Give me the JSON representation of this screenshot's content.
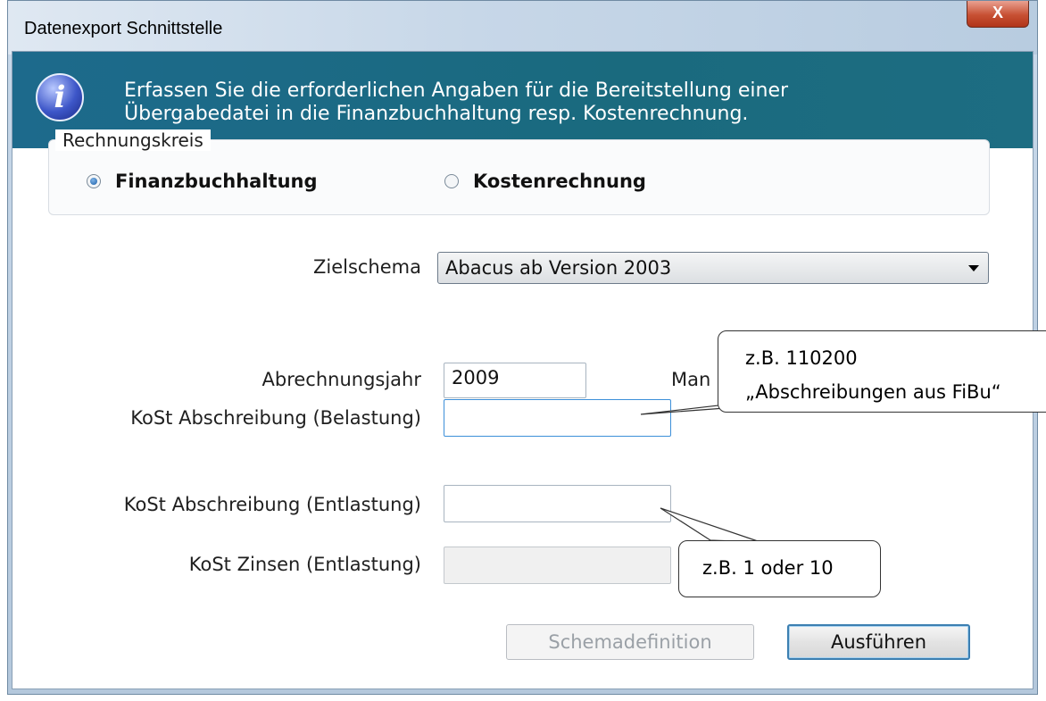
{
  "window": {
    "title": "Datenexport Schnittstelle",
    "close_glyph": "X"
  },
  "banner": {
    "icon": "info-icon",
    "line1": "Erfassen Sie die erforderlichen Angaben für die Bereitstellung einer",
    "line2": "Übergabedatei in die Finanzbuchhaltung resp. Kostenrechnung."
  },
  "group": {
    "legend": "Rechnungskreis",
    "options": [
      {
        "label": "Finanzbuchhaltung",
        "checked": true
      },
      {
        "label": "Kostenrechnung",
        "checked": false
      }
    ]
  },
  "form": {
    "zielschema_label": "Zielschema",
    "zielschema_value": "Abacus ab Version 2003",
    "abrechnungsjahr_label": "Abrechnungsjahr",
    "abrechnungsjahr_value": "2009",
    "mandant_label_partial": "Man",
    "kost_belastung_label": "KoSt Abschreibung (Belastung)",
    "kost_belastung_value": "",
    "kost_entlastung_label": "KoSt Abschreibung (Entlastung)",
    "kost_entlastung_value": "",
    "kost_zinsen_label": "KoSt Zinsen (Entlastung)",
    "kost_zinsen_value": ""
  },
  "buttons": {
    "schemadefinition": "Schemadefinition",
    "ausfuehren": "Ausführen"
  },
  "callouts": {
    "top_line1": "z.B. 110200",
    "top_line2": "„Abschreibungen aus FiBu“",
    "bottom": "z.B. 1 oder 10"
  },
  "colors": {
    "banner": "#1a6a7e",
    "close_button": "#c75033",
    "focus_border": "#3c8fd9"
  }
}
